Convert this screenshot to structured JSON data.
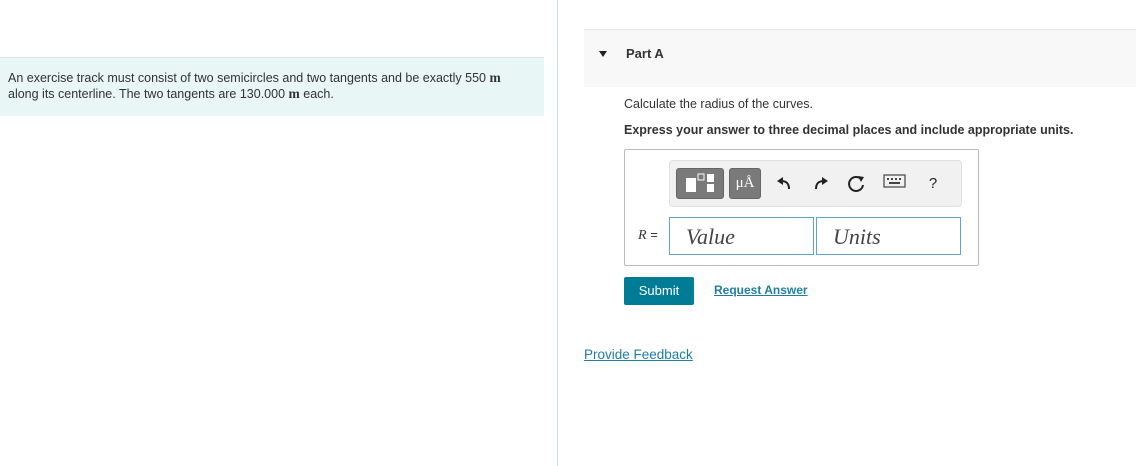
{
  "problem": {
    "line1_text": "An exercise track must consist of two semicircles and two tangents and be exactly 550",
    "line1_unit": "m",
    "line2_text": "along its centerline. The two tangents are 130.000",
    "line2_unit": "m",
    "line2_tail": "each."
  },
  "part": {
    "title": "Part A",
    "question": "Calculate the radius of the curves.",
    "instruction": "Express your answer to three decimal places and include appropriate units."
  },
  "toolbar": {
    "units_button_label": "μÅ",
    "help_label": "?"
  },
  "answer": {
    "variable": "R",
    "equals": "=",
    "value_placeholder": "Value",
    "units_placeholder": "Units"
  },
  "actions": {
    "submit_label": "Submit",
    "request_answer_label": "Request Answer"
  },
  "footer": {
    "feedback_label": "Provide Feedback"
  },
  "colors": {
    "accent": "#007c97",
    "link": "#1f7fa3",
    "problem_bg": "#e8f6f6",
    "field_border": "#5ca7c9"
  }
}
